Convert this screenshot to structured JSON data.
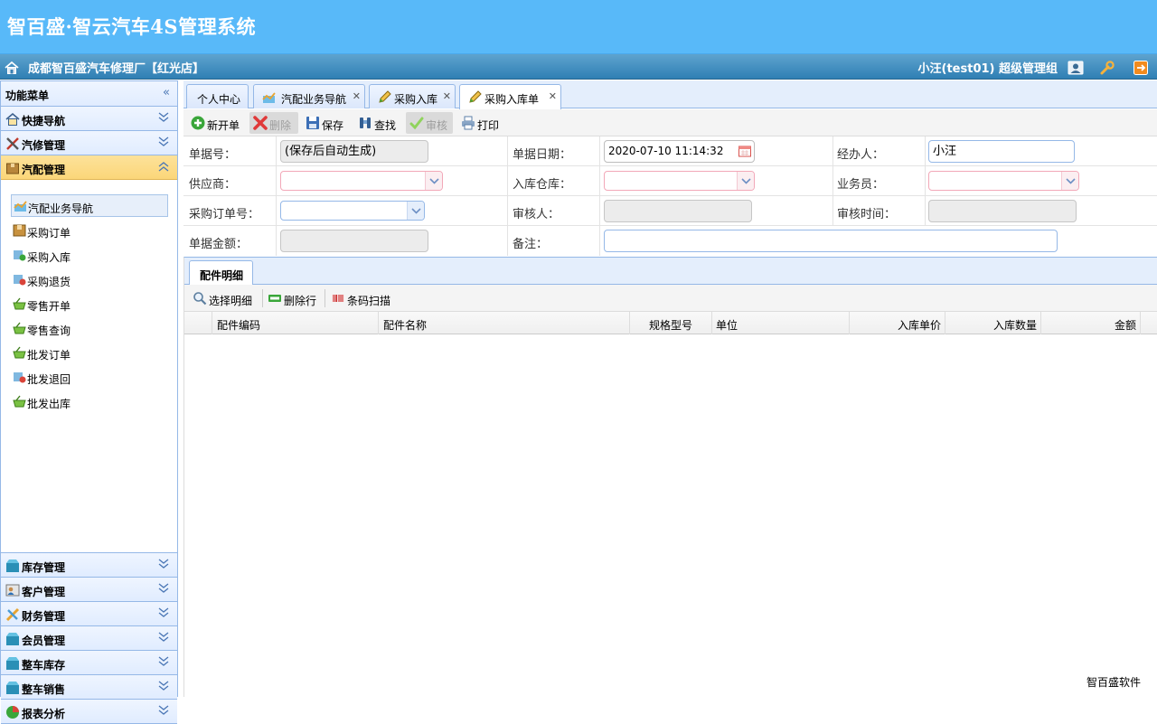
{
  "header": {
    "title": "智百盛·智云汽车4S管理系统"
  },
  "subbar": {
    "company": "成都智百盛汽车修理厂【红光店】",
    "user": "小汪(test01)  超级管理组"
  },
  "sidebar": {
    "title": "功能菜单",
    "top_sections": [
      {
        "label": "快捷导航"
      },
      {
        "label": "汽修管理"
      },
      {
        "label": "汽配管理"
      }
    ],
    "items": [
      {
        "label": "汽配业务导航"
      },
      {
        "label": "采购订单"
      },
      {
        "label": "采购入库"
      },
      {
        "label": "采购退货"
      },
      {
        "label": "零售开单"
      },
      {
        "label": "零售查询"
      },
      {
        "label": "批发订单"
      },
      {
        "label": "批发退回"
      },
      {
        "label": "批发出库"
      }
    ],
    "bottom_sections": [
      {
        "label": "库存管理"
      },
      {
        "label": "客户管理"
      },
      {
        "label": "财务管理"
      },
      {
        "label": "会员管理"
      },
      {
        "label": "整车库存"
      },
      {
        "label": "整车销售"
      },
      {
        "label": "报表分析"
      }
    ]
  },
  "tabs": [
    {
      "label": "个人中心"
    },
    {
      "label": "汽配业务导航"
    },
    {
      "label": "采购入库"
    },
    {
      "label": "采购入库单"
    }
  ],
  "toolbar": {
    "new": "新开单",
    "delete": "删除",
    "save": "保存",
    "find": "查找",
    "audit": "审核",
    "print": "打印"
  },
  "form": {
    "doc_no_label": "单据号：",
    "doc_no_value": "(保存后自动生成)",
    "doc_date_label": "单据日期：",
    "doc_date_value": "2020-07-10 11:14:32",
    "handler_label": "经办人：",
    "handler_value": "小汪",
    "supplier_label": "供应商：",
    "warehouse_label": "入库仓库：",
    "salesman_label": "业务员：",
    "po_no_label": "采购订单号：",
    "auditor_label": "审核人：",
    "audit_time_label": "审核时间：",
    "amount_label": "单据金额：",
    "remark_label": "备注："
  },
  "detail": {
    "tab": "配件明细",
    "toolbar": {
      "select": "选择明细",
      "delete_row": "删除行",
      "barcode": "条码扫描"
    },
    "columns": [
      "配件编码",
      "配件名称",
      "规格型号",
      "单位",
      "入库单价",
      "入库数量",
      "金额"
    ]
  },
  "footer": {
    "brand": "智百盛软件"
  },
  "colors": {
    "header_bg": "#58b9f9",
    "subbar_bg": "#2f7fb4",
    "accent_active": "#fbd679"
  }
}
